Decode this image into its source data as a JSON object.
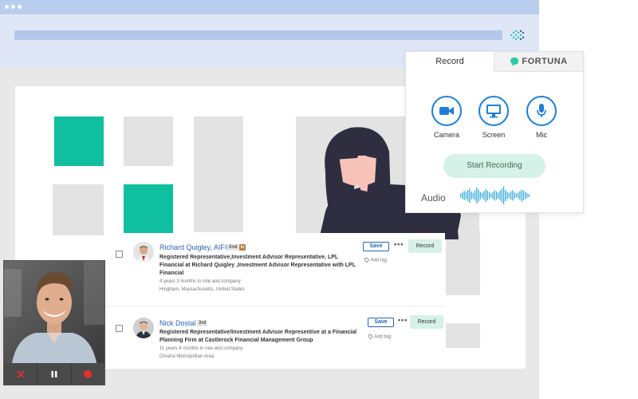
{
  "colors": {
    "accent_teal": "#0fbf9f",
    "accent_blue": "#1f7fd8",
    "record_green": "#d6f1e7",
    "link_blue": "#2a62b4",
    "stop_red": "#e8302f"
  },
  "recorder": {
    "tabs": [
      {
        "label": "Record",
        "active": true
      },
      {
        "label": "FORTUNA",
        "active": false
      }
    ],
    "sources": [
      {
        "label": "Camera",
        "icon": "camera-icon"
      },
      {
        "label": "Screen",
        "icon": "monitor-icon"
      },
      {
        "label": "Mic",
        "icon": "microphone-icon"
      }
    ],
    "start_label": "Start Recording",
    "audio_label": "Audio"
  },
  "results": [
    {
      "name": "Richard Quigley, AIF®",
      "degree": "2nd",
      "badge": "in",
      "headline": "Registered Representative,Investment Advisor Representative, LPL Financial at Richard Quigley ,Investment Advisor Representative with LPL Financial",
      "tenure": "4 years 3 months in role and company",
      "location": "Hingham, Massachusetts, United States",
      "save_label": "Save",
      "record_label": "Record",
      "tag_label": "Add tag"
    },
    {
      "name": "Nick Dostal",
      "degree": "3rd",
      "headline": "Registered Representative/Investment Advisor Representive at a Financial Planning Firm at Castlerock Financial Management Group",
      "tenure": "11 years 4 months in role and company",
      "location": "Omaha Metropolitan Area",
      "save_label": "Save",
      "record_label": "Record",
      "tag_label": "Add tag"
    }
  ],
  "webcam": {
    "controls": [
      {
        "icon": "close-icon"
      },
      {
        "icon": "pause-icon"
      },
      {
        "icon": "record-icon"
      }
    ]
  }
}
